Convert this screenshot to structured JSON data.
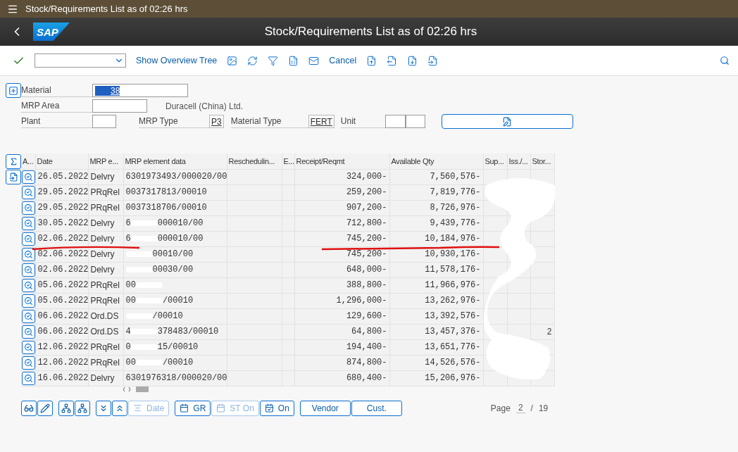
{
  "window": {
    "title": "Stock/Requirements List as of 02:26 hrs"
  },
  "header": {
    "logo": "SAP",
    "title": "Stock/Requirements List as of 02:26 hrs"
  },
  "toolbar": {
    "buttons": [
      {
        "kind": "check"
      },
      {
        "kind": "dropdown"
      },
      {
        "kind": "text",
        "label": "Show Overview Tree"
      },
      {
        "kind": "icon"
      },
      {
        "kind": "icon"
      },
      {
        "kind": "icon"
      },
      {
        "kind": "icon"
      },
      {
        "kind": "icon"
      },
      {
        "kind": "text",
        "label": "Cancel"
      },
      {
        "kind": "icon"
      },
      {
        "kind": "icon"
      },
      {
        "kind": "icon"
      },
      {
        "kind": "icon"
      }
    ]
  },
  "form": {
    "material": {
      "label": "Material",
      "value": "38"
    },
    "mrp_area": {
      "label": "MRP Area",
      "description": "Duracell (China) Ltd."
    },
    "plant": {
      "label": "Plant"
    },
    "mrp_type": {
      "label": "MRP Type",
      "value": "P3"
    },
    "material_type": {
      "label": "Material Type",
      "value": "FERT"
    },
    "unit": {
      "label": "Unit"
    }
  },
  "table": {
    "columns": [
      "A...",
      "Date",
      "MRP e...",
      "MRP element data",
      "Reschedulin...",
      "E...",
      "Receipt/Reqmt",
      "Available Qty",
      "Sup...",
      "Iss./...",
      "Stor..."
    ],
    "rows": [
      {
        "date": "26.05.2022",
        "element": "Delvry",
        "data": {
          "head": "6301973493/000020/00"
        },
        "receipt": "324,000-",
        "available": "7,560,576-"
      },
      {
        "date": "29.05.2022",
        "element": "PRqRel",
        "data": {
          "head": "0037317813/00010"
        },
        "receipt": "259,200-",
        "available": "7,819,776-"
      },
      {
        "date": "29.05.2022",
        "element": "PRqRel",
        "data": {
          "head": "0037318706/00010"
        },
        "receipt": "907,200-",
        "available": "8,726,976-"
      },
      {
        "date": "30.05.2022",
        "element": "Delvry",
        "data": {
          "head": "6",
          "tail": "000010/00"
        },
        "receipt": "712,800-",
        "available": "9,439,776-"
      },
      {
        "date": "02.06.2022",
        "element": "Delvry",
        "data": {
          "head": "6",
          "tail": "000010/00"
        },
        "receipt": "745,200-",
        "available": "10,184,976-"
      },
      {
        "date": "02.06.2022",
        "element": "Delvry",
        "data": {
          "tail": "00010/00"
        },
        "receipt": "745,200-",
        "available": "10,930,176-"
      },
      {
        "date": "02.06.2022",
        "element": "Delvry",
        "data": {
          "tail": "00030/00"
        },
        "receipt": "648,000-",
        "available": "11,578,176-"
      },
      {
        "date": "05.06.2022",
        "element": "PRqRel",
        "data": {
          "head": "00"
        },
        "receipt": "388,800-",
        "available": "11,966,976-"
      },
      {
        "date": "05.06.2022",
        "element": "PRqRel",
        "data": {
          "head": "00",
          "tail": "/00010"
        },
        "receipt": "1,296,000-",
        "available": "13,262,976-"
      },
      {
        "date": "06.06.2022",
        "element": "Ord.DS",
        "data": {
          "tail": "/00010"
        },
        "receipt": "129,600-",
        "available": "13,392,576-"
      },
      {
        "date": "06.06.2022",
        "element": "Ord.DS",
        "data": {
          "head": "4",
          "tail": "378483/00010"
        },
        "receipt": "64,800-",
        "available": "13,457,376-",
        "stor": "2"
      },
      {
        "date": "12.06.2022",
        "element": "PRqRel",
        "data": {
          "head": "0",
          "tail": "15/00010"
        },
        "receipt": "194,400-",
        "available": "13,651,776-"
      },
      {
        "date": "12.06.2022",
        "element": "PRqRel",
        "data": {
          "head": "00",
          "tail": "/00010"
        },
        "receipt": "874,800-",
        "available": "14,526,576-"
      },
      {
        "date": "16.06.2022",
        "element": "Delvry",
        "data": {
          "head": "6301976318/000020/00"
        },
        "receipt": "680,400-",
        "available": "15,206,976-"
      }
    ]
  },
  "bottom_toolbar": {
    "groups": [
      [
        {
          "kind": "icon",
          "disabled": false
        },
        {
          "kind": "icon",
          "disabled": false
        }
      ],
      [
        {
          "kind": "icon",
          "disabled": false
        },
        {
          "kind": "icon",
          "disabled": false
        }
      ],
      [
        {
          "kind": "icon",
          "disabled": false
        },
        {
          "kind": "icon",
          "disabled": false
        },
        {
          "kind": "icon-text",
          "label": "Date",
          "disabled": true
        }
      ],
      [
        {
          "kind": "icon-text",
          "label": "GR",
          "disabled": false
        },
        {
          "kind": "icon-text",
          "label": "ST On",
          "disabled": true
        },
        {
          "kind": "icon-text",
          "label": "On",
          "disabled": false
        }
      ],
      [
        {
          "kind": "text",
          "label": "Vendor",
          "disabled": false
        },
        {
          "kind": "text",
          "label": "Cust.",
          "disabled": false
        }
      ]
    ]
  },
  "pager": {
    "label": "Page",
    "current": "2",
    "separator": "/",
    "total": "19"
  }
}
